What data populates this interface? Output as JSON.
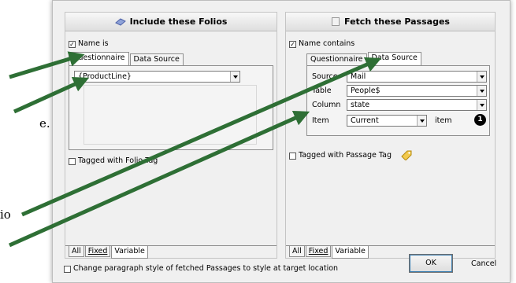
{
  "left_panel": {
    "title": "Include these Folios",
    "name_checkbox_label": "Name is",
    "tabs": [
      "Questionnaire",
      "Data Source"
    ],
    "value": "{ProductLine}",
    "tagged_label": "Tagged with Folio Tag",
    "bottom_tabs": [
      "All",
      "Fixed",
      "Variable"
    ]
  },
  "right_panel": {
    "title": "Fetch these Passages",
    "name_checkbox_label": "Name contains",
    "tabs": [
      "Questionnaire",
      "Data Source"
    ],
    "fields": {
      "source_label": "Source",
      "source_value": "Mail",
      "table_label": "Table",
      "table_value": "People$",
      "column_label": "Column",
      "column_value": "state",
      "item_label": "Item",
      "item_value": "Current",
      "item_suffix": "item",
      "item_badge": "1"
    },
    "tagged_label": "Tagged with Passage Tag",
    "bottom_tabs": [
      "All",
      "Fixed",
      "Variable"
    ]
  },
  "footer": {
    "change_style_label": "Change paragraph style of fetched Passages to style at target location",
    "ok_label": "OK",
    "cancel_label": "Cancel"
  },
  "annotations": {
    "fragment_e": "e.",
    "fragment_io": "io"
  },
  "colors": {
    "arrow": "#2e6f35"
  }
}
